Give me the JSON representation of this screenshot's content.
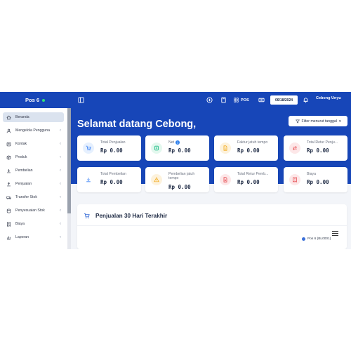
{
  "topbar": {
    "brand": "Pos 6",
    "pos_label": "POS",
    "date": "06/18/2024",
    "user": "Cebong Unyu"
  },
  "sidebar": {
    "items": [
      {
        "label": "Beranda",
        "icon": "home-icon",
        "active": true,
        "chevron": ""
      },
      {
        "label": "Mengelola Pengguna",
        "icon": "users-icon",
        "chevron": "‹"
      },
      {
        "label": "Kontak",
        "icon": "contact-icon",
        "chevron": "‹"
      },
      {
        "label": "Produk",
        "icon": "box-icon",
        "chevron": "‹"
      },
      {
        "label": "Pembelian",
        "icon": "download-icon",
        "chevron": "‹"
      },
      {
        "label": "Penjualan",
        "icon": "upload-icon",
        "chevron": "‹"
      },
      {
        "label": "Transfer Stok",
        "icon": "truck-icon",
        "chevron": "‹"
      },
      {
        "label": "Penyesuaian Stok",
        "icon": "database-icon",
        "chevron": "‹"
      },
      {
        "label": "Biaya",
        "icon": "receipt-icon",
        "chevron": "‹"
      },
      {
        "label": "Laporan",
        "icon": "chart-icon",
        "chevron": "‹"
      }
    ]
  },
  "main": {
    "welcome": "Selamat datang Cebong,",
    "filter_label": "Filter menurut tanggal",
    "cards": [
      {
        "label": "Total Penjualan",
        "value": "Rp 0.00",
        "icon": "cart-icon",
        "color": "#3b82f6",
        "bg": "#e6f0fe"
      },
      {
        "label": "Net",
        "value": "Rp 0.00",
        "icon": "wallet-icon",
        "color": "#10b981",
        "bg": "#e3f8ee",
        "info": "i"
      },
      {
        "label": "Faktur jatuh tempo",
        "value": "Rp 0.00",
        "icon": "invoice-icon",
        "color": "#f2a91a",
        "bg": "#fdf2dc"
      },
      {
        "label": "Total Retur Penju...",
        "value": "Rp 0.00",
        "icon": "swap-icon",
        "color": "#e5484d",
        "bg": "#fde7e8"
      },
      {
        "label": "Total Pembelian",
        "value": "Rp 0.00",
        "icon": "download-icon",
        "color": "#3b82f6",
        "bg": "#ffffff"
      },
      {
        "label": "Pembelian jatuh tempo",
        "value": "Rp 0.00",
        "icon": "warning-icon",
        "color": "#f2a91a",
        "bg": "#fdf2dc"
      },
      {
        "label": "Total Retur Pemb...",
        "value": "Rp 0.00",
        "icon": "file-icon",
        "color": "#e5484d",
        "bg": "#fde7e8"
      },
      {
        "label": "Biaya",
        "value": "Rp 0.00",
        "icon": "receipt-icon",
        "color": "#e5484d",
        "bg": "#fde7e8"
      }
    ],
    "sales_panel": {
      "title": "Penjualan 30 Hari Terakhir",
      "legend": "Pos 6 (BL0001)"
    }
  }
}
